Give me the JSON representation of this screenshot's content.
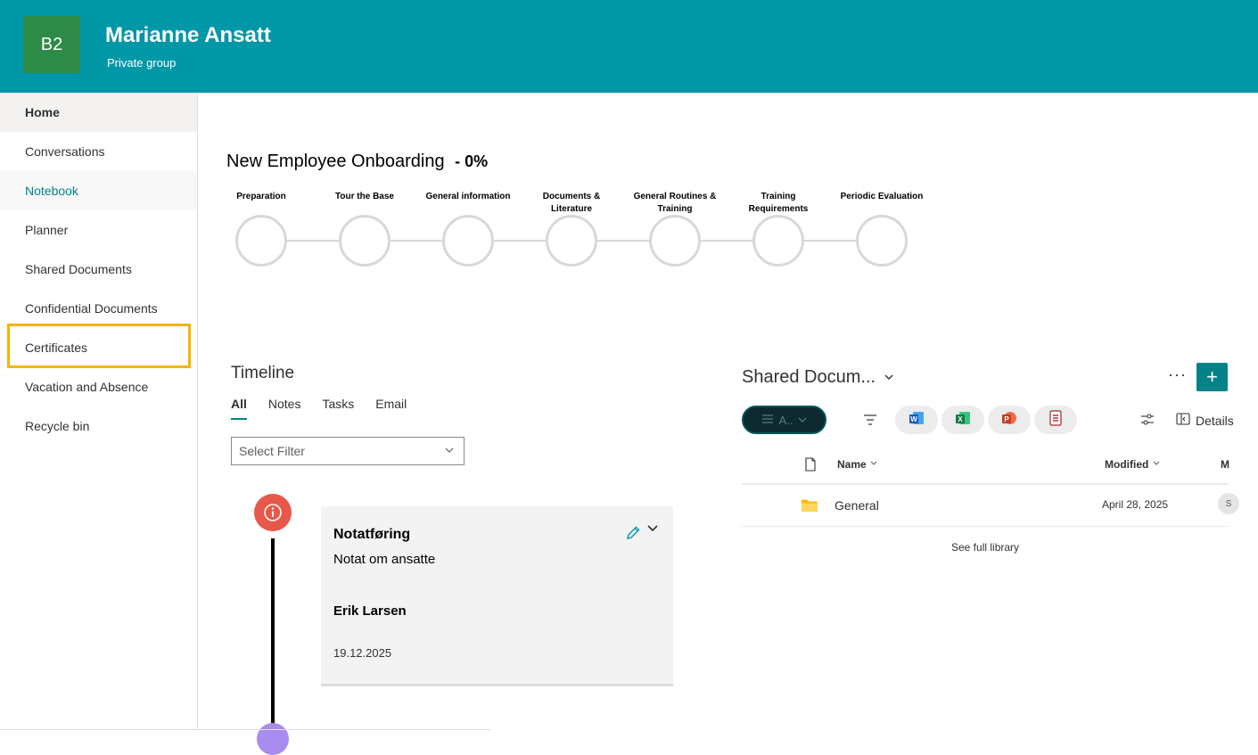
{
  "header": {
    "logo_text": "B2",
    "title": "Marianne Ansatt",
    "subtitle": "Private group"
  },
  "nav": {
    "items": [
      {
        "label": "Home"
      },
      {
        "label": "Conversations"
      },
      {
        "label": "Notebook"
      },
      {
        "label": "Planner"
      },
      {
        "label": "Shared Documents"
      },
      {
        "label": "Confidential Documents"
      },
      {
        "label": "Certificates"
      },
      {
        "label": "Vacation and Absence"
      },
      {
        "label": "Recycle bin"
      }
    ]
  },
  "onboarding": {
    "title": "New Employee Onboarding",
    "percent": "- 0%",
    "progress": 0,
    "steps": [
      {
        "label": "Preparation"
      },
      {
        "label": "Tour the Base"
      },
      {
        "label": "General information"
      },
      {
        "label": "Documents & Literature"
      },
      {
        "label": "General Routines & Training"
      },
      {
        "label": "Training Requirements"
      },
      {
        "label": "Periodic Evaluation"
      }
    ]
  },
  "timeline": {
    "title": "Timeline",
    "tabs": [
      {
        "label": "All"
      },
      {
        "label": "Notes"
      },
      {
        "label": "Tasks"
      },
      {
        "label": "Email"
      }
    ],
    "filter_placeholder": "Select Filter",
    "card": {
      "title": "Notatføring",
      "subtitle": "Notat om ansatte",
      "author": "Erik Larsen",
      "date": "19.12.2025"
    }
  },
  "documents": {
    "title": "Shared Docum...",
    "more_label": "···",
    "add_label": "+",
    "view_label": "A..",
    "details_label": "Details",
    "columns": {
      "name": "Name",
      "modified": "Modified",
      "modified_by": "M"
    },
    "rows": [
      {
        "name": "General",
        "modified": "April 28, 2025",
        "avatar": "S"
      }
    ],
    "see_full": "See full library",
    "apps": [
      {
        "icon": "word-icon",
        "letter": "W",
        "color": "#185abd"
      },
      {
        "icon": "excel-icon",
        "letter": "X",
        "color": "#107c41"
      },
      {
        "icon": "powerpoint-icon",
        "letter": "P",
        "color": "#c43e1c"
      },
      {
        "icon": "form-icon",
        "letter": "",
        "color": "#a4262c"
      }
    ]
  },
  "colors": {
    "header": "#0097a7",
    "accent": "#038387",
    "logo": "#2e8b47",
    "timeline_note": "#e8584a"
  }
}
